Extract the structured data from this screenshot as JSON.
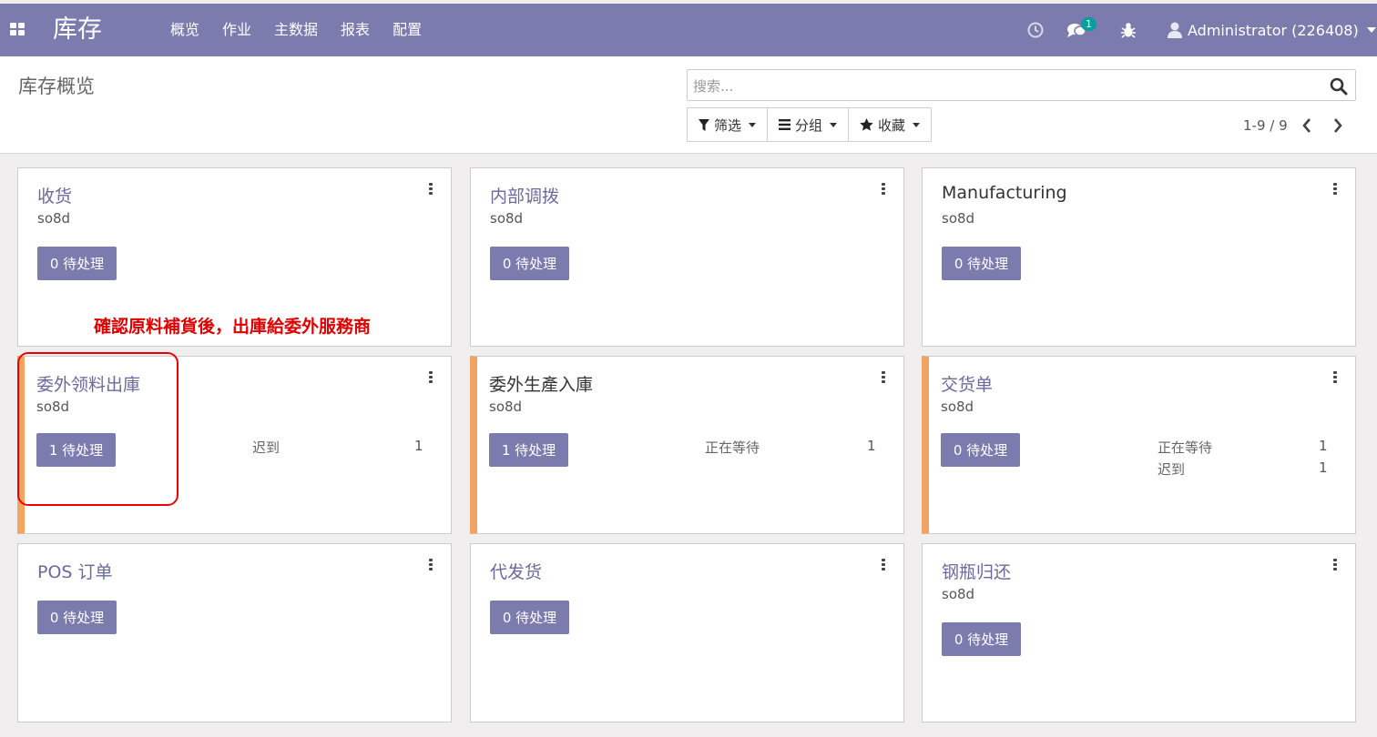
{
  "navbar": {
    "brand": "库存",
    "menu": [
      "概览",
      "作业",
      "主数据",
      "报表",
      "配置"
    ],
    "chat_count": "1",
    "user": "Administrator (226408)",
    "color": "#7c7bad"
  },
  "control": {
    "title": "库存概览",
    "search_placeholder": "搜索...",
    "filter_label": "筛选",
    "group_label": "分组",
    "favorite_label": "收藏",
    "pager": "1-9 / 9"
  },
  "annotation": "確認原料補貨後，出庫給委外服務商",
  "cards": [
    {
      "title": "收货",
      "sub": "so8d",
      "button": "0 待处理",
      "stats": []
    },
    {
      "title": "内部调拨",
      "sub": "so8d",
      "button": "0 待处理",
      "stats": []
    },
    {
      "title": "Manufacturing",
      "sub": "so8d",
      "button": "0 待处理",
      "stats": []
    },
    {
      "title": "委外领料出庫",
      "sub": "so8d",
      "button": "1 待处理",
      "stats": [
        {
          "label": "迟到",
          "value": "1"
        }
      ]
    },
    {
      "title": "委外生產入庫",
      "sub": "so8d",
      "button": "1 待处理",
      "stats": [
        {
          "label": "正在等待",
          "value": "1"
        }
      ]
    },
    {
      "title": "交货单",
      "sub": "so8d",
      "button": "0 待处理",
      "stats": [
        {
          "label": "正在等待",
          "value": "1"
        },
        {
          "label": "迟到",
          "value": "1"
        }
      ]
    },
    {
      "title": "POS 订单",
      "sub": "",
      "button": "0 待处理",
      "stats": []
    },
    {
      "title": "代发货",
      "sub": "",
      "button": "0 待处理",
      "stats": []
    },
    {
      "title": "钢瓶归还",
      "sub": "so8d",
      "button": "0 待处理",
      "stats": []
    }
  ],
  "accent_color": "#f0a563"
}
